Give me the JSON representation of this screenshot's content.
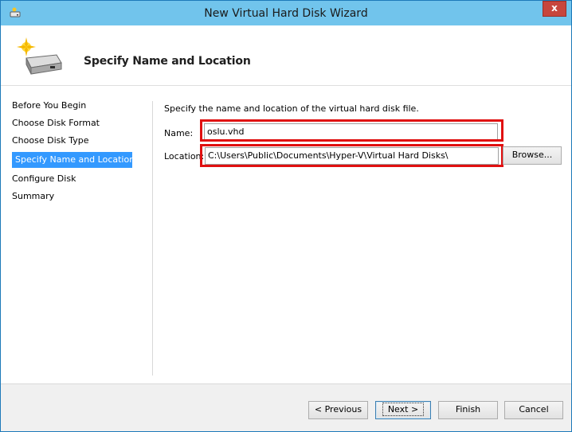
{
  "window": {
    "title": "New Virtual Hard Disk Wizard",
    "close_label": "x"
  },
  "header": {
    "heading": "Specify Name and Location"
  },
  "sidebar": {
    "items": [
      {
        "label": "Before You Begin",
        "active": false
      },
      {
        "label": "Choose Disk Format",
        "active": false
      },
      {
        "label": "Choose Disk Type",
        "active": false
      },
      {
        "label": "Specify Name and Location",
        "active": true
      },
      {
        "label": "Configure Disk",
        "active": false
      },
      {
        "label": "Summary",
        "active": false
      }
    ]
  },
  "main": {
    "description": "Specify the name and location of the virtual hard disk file.",
    "name_label": "Name:",
    "name_value": "oslu.vhd",
    "location_label": "Location:",
    "location_value": "C:\\Users\\Public\\Documents\\Hyper-V\\Virtual Hard Disks\\",
    "browse_label": "Browse..."
  },
  "footer": {
    "previous_label": "< Previous",
    "next_label": "Next >",
    "finish_label": "Finish",
    "cancel_label": "Cancel"
  },
  "colors": {
    "titlebar": "#71c4ec",
    "selection": "#3399ff",
    "highlight_box": "#e01010",
    "close_button": "#c7463d"
  }
}
